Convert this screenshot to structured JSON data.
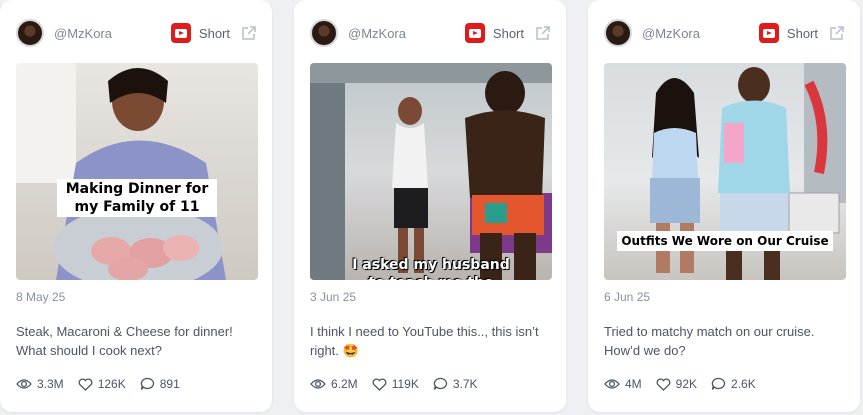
{
  "cards": [
    {
      "handle": "@MzKora",
      "platform": "Short",
      "caption": "Making Dinner for my Family of 11",
      "date": "8 May 25",
      "description": "Steak, Macaroni & Cheese for dinner! What should I cook next?",
      "views": "3.3M",
      "likes": "126K",
      "comments": "891"
    },
    {
      "handle": "@MzKora",
      "platform": "Short",
      "caption": "I asked my husband to teach me the Cupid shuffle",
      "date": "3 Jun 25",
      "description": "I think I need to YouTube this.., this isn’t right. 🤩",
      "views": "6.2M",
      "likes": "119K",
      "comments": "3.7K"
    },
    {
      "handle": "@MzKora",
      "platform": "Short",
      "caption": "Outfits We Wore on Our Cruise",
      "date": "6 Jun 25",
      "description": "Tried to matchy match on our cruise. How’d we do?",
      "views": "4M",
      "likes": "92K",
      "comments": "2.6K"
    }
  ],
  "icons": {
    "platform": "youtube-icon",
    "external": "external-link-icon",
    "views": "eye-icon",
    "likes": "heart-icon",
    "comments": "comment-icon"
  },
  "colors": {
    "youtube": "#e01b1b",
    "text": "#4c5567",
    "muted": "#8a909c"
  }
}
